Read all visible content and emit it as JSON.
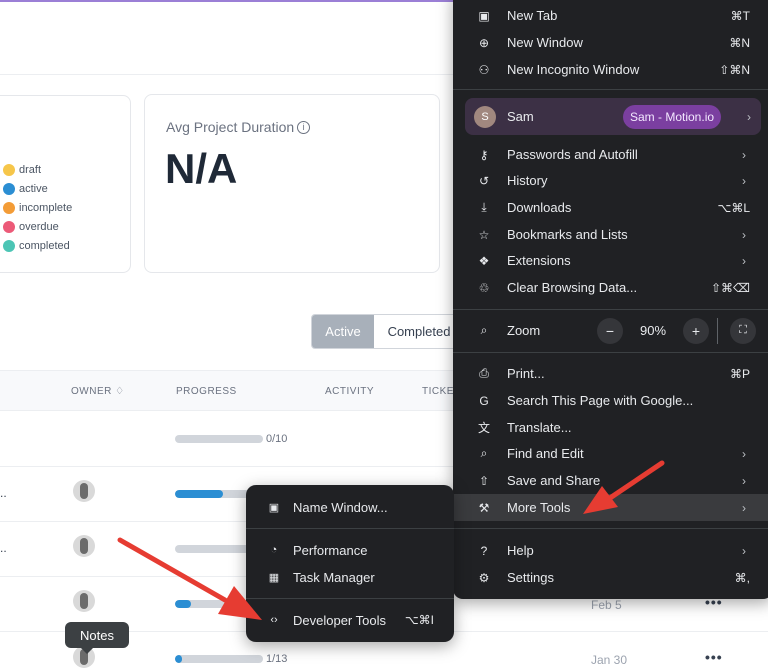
{
  "status_card": {
    "legend": [
      {
        "label": "draft",
        "color": "#f6c64a"
      },
      {
        "label": "active",
        "color": "#2b8ed3"
      },
      {
        "label": "incomplete",
        "color": "#f39c37"
      },
      {
        "label": "overdue",
        "color": "#ec5a78"
      },
      {
        "label": "completed",
        "color": "#4cc5b5"
      }
    ]
  },
  "duration_card": {
    "title": "Avg Project Duration",
    "info_glyph": "i",
    "value": "N/A"
  },
  "toggle": {
    "active_label": "Active",
    "completed_label": "Completed"
  },
  "table": {
    "headers": {
      "owner": "OWNER",
      "owner_sort": "♢",
      "progress": "PROGRESS",
      "activity": "ACTIVITY",
      "tickets": "TICKET"
    },
    "rows": [
      {
        "progress_text": "0/10",
        "progress": 0.0,
        "date": "",
        "ellipsis": ""
      },
      {
        "progress_text": "",
        "progress": 0.55,
        "date": "",
        "ellipsis": ".."
      },
      {
        "progress_text": "",
        "progress": 0.0,
        "date": "",
        "ellipsis": ".."
      },
      {
        "progress_text": "",
        "progress": 0.18,
        "date": "Feb 5",
        "ellipsis": ""
      },
      {
        "progress_text": "1/13",
        "progress": 0.08,
        "date": "Jan 30",
        "ellipsis": ""
      }
    ],
    "more_glyph": "•••"
  },
  "tooltip": {
    "label": "Notes"
  },
  "chrome_menu": {
    "new_tab": {
      "label": "New Tab",
      "shortcut": "⌘T",
      "icon": "▣"
    },
    "new_window": {
      "label": "New Window",
      "shortcut": "⌘N",
      "icon": "⊕"
    },
    "new_incognito": {
      "label": "New Incognito Window",
      "shortcut": "⇧⌘N",
      "icon": "⚇"
    },
    "profile": {
      "initial": "S",
      "name": "Sam",
      "badge": "Sam - Motion.io",
      "chevron": "›"
    },
    "passwords": {
      "label": "Passwords and Autofill",
      "icon": "⚷",
      "chevron": "›"
    },
    "history": {
      "label": "History",
      "icon": "↺",
      "chevron": "›"
    },
    "downloads": {
      "label": "Downloads",
      "shortcut": "⌥⌘L",
      "icon": "⤓"
    },
    "bookmarks": {
      "label": "Bookmarks and Lists",
      "icon": "☆",
      "chevron": "›"
    },
    "extensions": {
      "label": "Extensions",
      "icon": "❖",
      "chevron": "›"
    },
    "clear_data": {
      "label": "Clear Browsing Data...",
      "shortcut": "⇧⌘⌫",
      "icon": "♲"
    },
    "zoom": {
      "label": "Zoom",
      "icon": "⌕",
      "minus": "−",
      "value": "90%",
      "plus": "+",
      "fullscreen": "⛶"
    },
    "print": {
      "label": "Print...",
      "shortcut": "⌘P",
      "icon": "⎙"
    },
    "search_google": {
      "label": "Search This Page with Google...",
      "icon": "G"
    },
    "translate": {
      "label": "Translate...",
      "icon": "文"
    },
    "find_edit": {
      "label": "Find and Edit",
      "icon": "⌕",
      "chevron": "›"
    },
    "save_share": {
      "label": "Save and Share",
      "icon": "⇧",
      "chevron": "›"
    },
    "more_tools": {
      "label": "More Tools",
      "icon": "⚒",
      "chevron": "›"
    },
    "help": {
      "label": "Help",
      "icon": "?",
      "chevron": "›"
    },
    "settings": {
      "label": "Settings",
      "shortcut": "⌘,",
      "icon": "⚙"
    }
  },
  "more_tools_menu": {
    "name_window": {
      "label": "Name Window...",
      "icon": "▣"
    },
    "performance": {
      "label": "Performance",
      "icon": "◔"
    },
    "task_manager": {
      "label": "Task Manager",
      "icon": "▦"
    },
    "developer_tools": {
      "label": "Developer Tools",
      "shortcut": "⌥⌘I",
      "icon": "‹›"
    }
  },
  "colors": {
    "arrow": "#e63c32",
    "menu_bg": "#202124",
    "menu_highlight": "#3a3b3e",
    "profile_badge": "#7b3fa0",
    "progress_fill": "#2b8ed3"
  }
}
